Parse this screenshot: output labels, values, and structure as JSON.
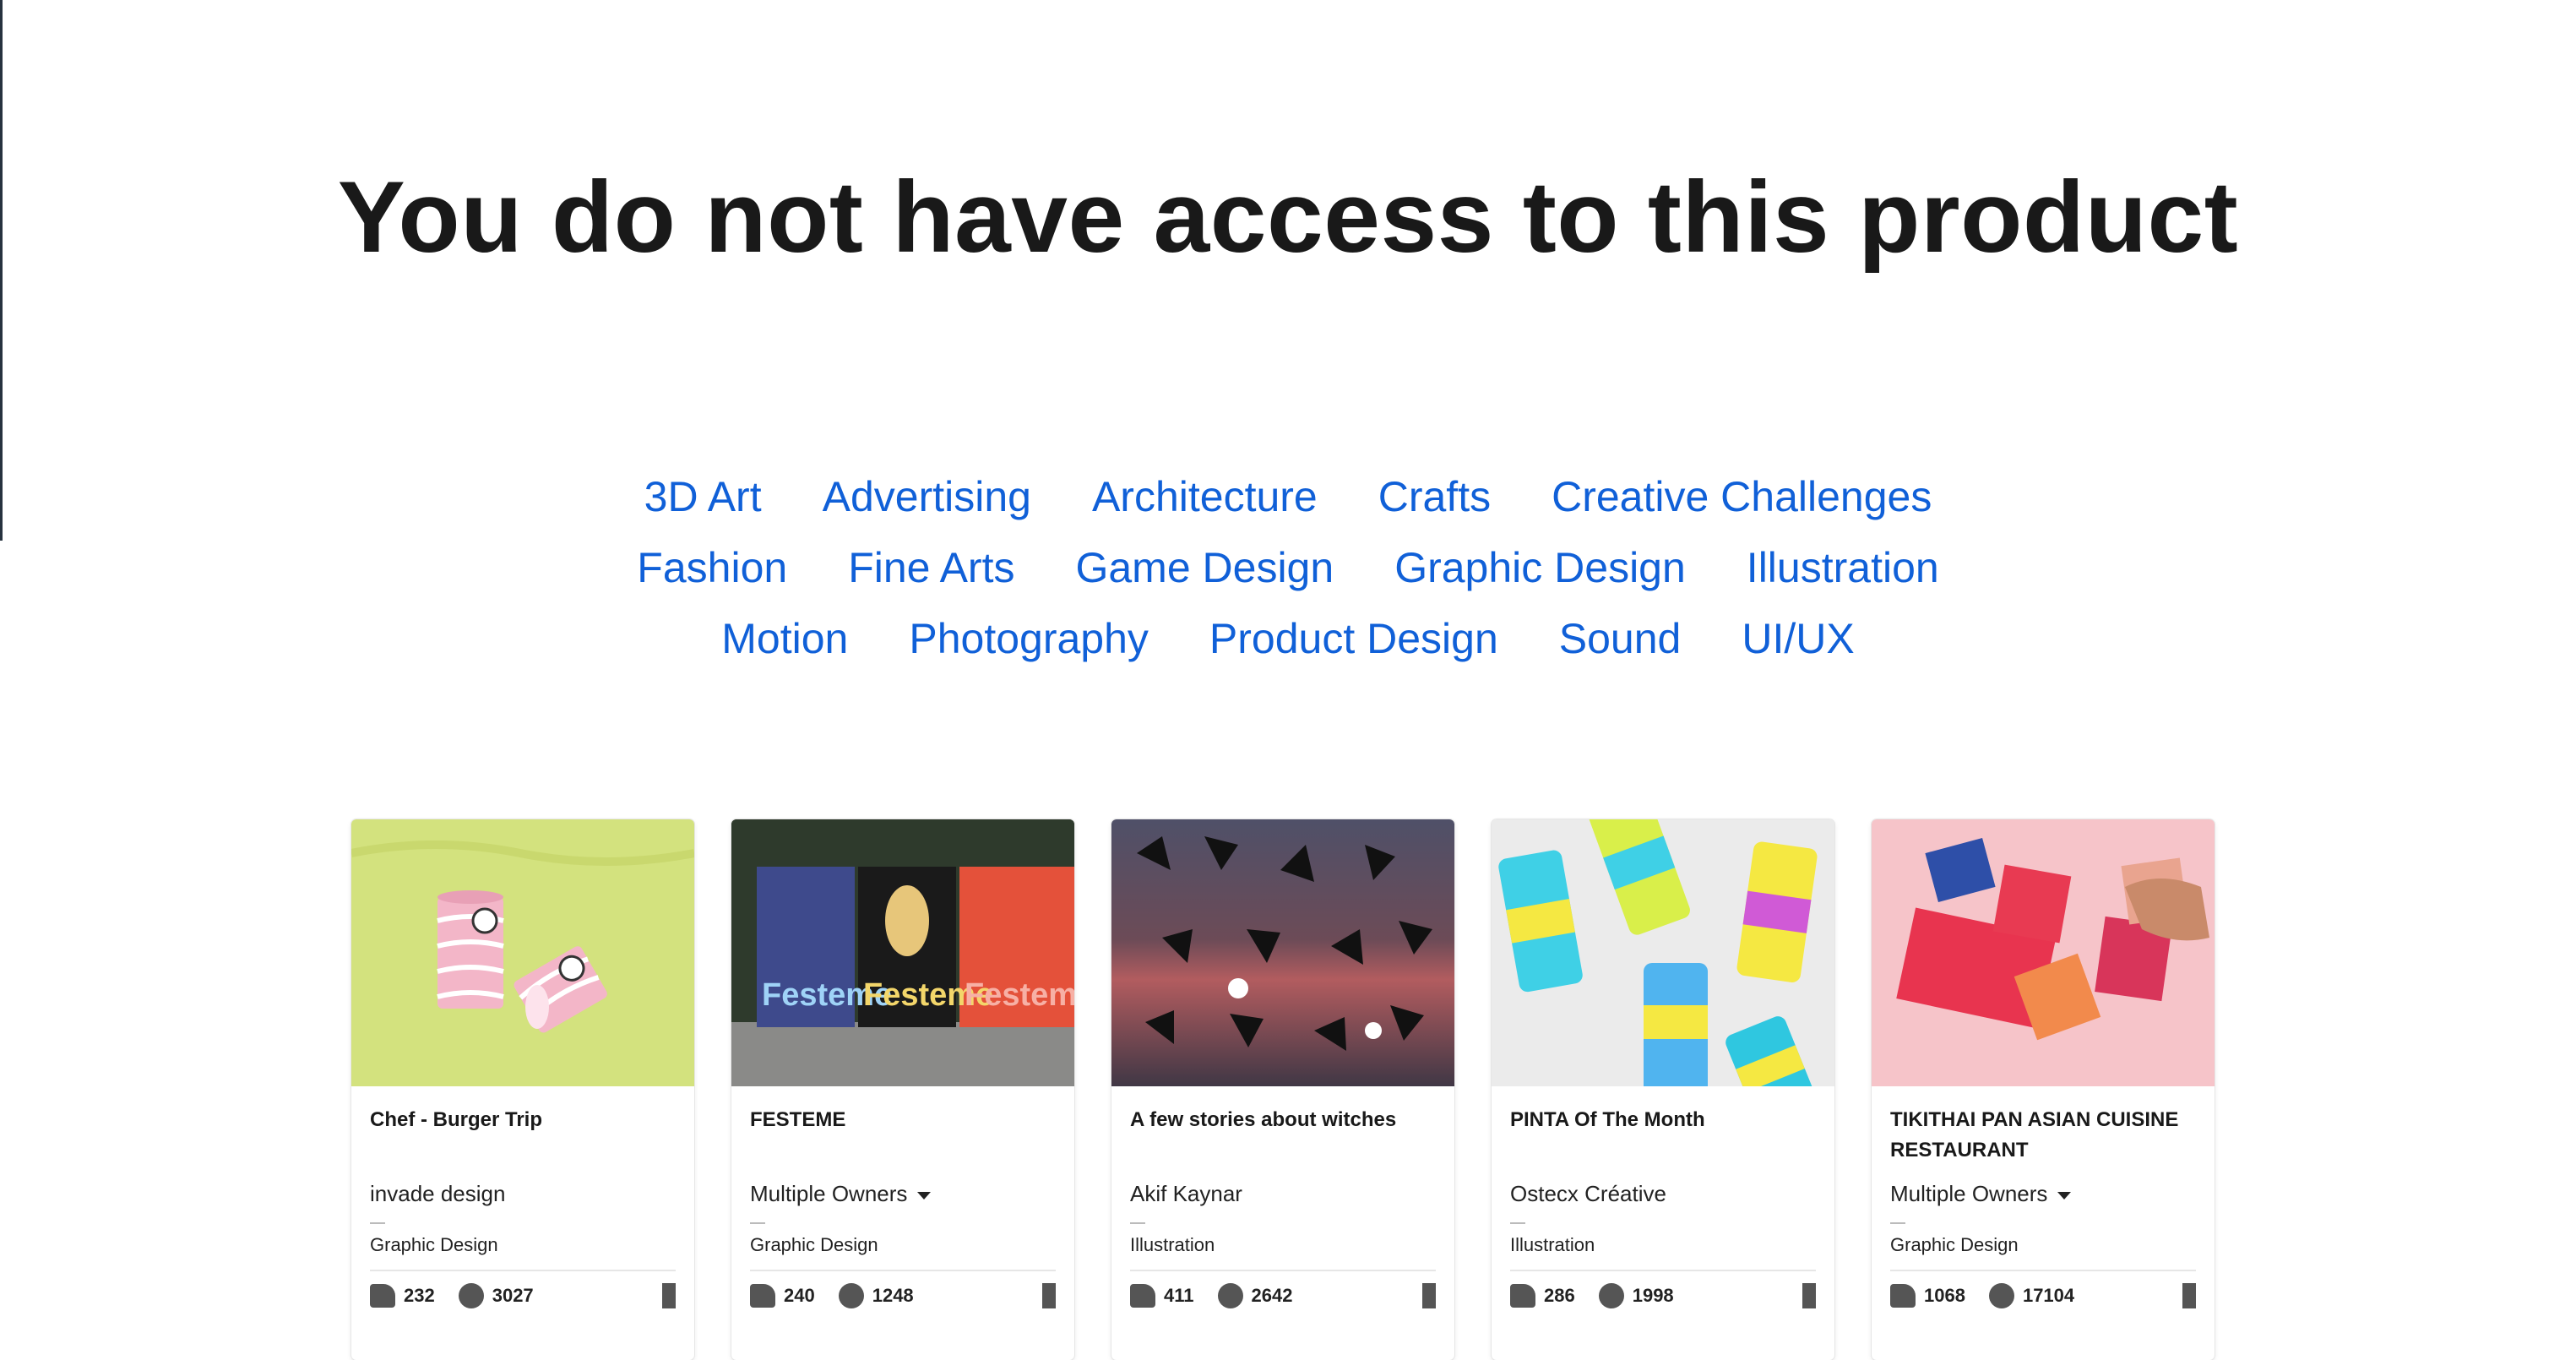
{
  "page": {
    "title": "You do not have access to this product"
  },
  "categories": [
    [
      "3D Art",
      "Advertising",
      "Architecture",
      "Crafts",
      "Creative Challenges"
    ],
    [
      "Fashion",
      "Fine Arts",
      "Game Design",
      "Graphic Design",
      "Illustration"
    ],
    [
      "Motion",
      "Photography",
      "Product Design",
      "Sound",
      "UI/UX"
    ]
  ],
  "cards": [
    {
      "title": "Chef - Burger Trip",
      "owner": "invade design",
      "owner_dropdown": false,
      "field": "Graphic Design",
      "likes": "232",
      "views": "3027"
    },
    {
      "title": "FESTEME",
      "owner": "Multiple Owners",
      "owner_dropdown": true,
      "field": "Graphic Design",
      "likes": "240",
      "views": "1248"
    },
    {
      "title": "A few stories about witches",
      "owner": "Akif Kaynar",
      "owner_dropdown": false,
      "field": "Illustration",
      "likes": "411",
      "views": "2642"
    },
    {
      "title": "PINTA Of The Month",
      "owner": "Ostecx Créative",
      "owner_dropdown": false,
      "field": "Illustration",
      "likes": "286",
      "views": "1998"
    },
    {
      "title": "TIKITHAI PAN ASIAN CUISINE RESTAURANT",
      "owner": "Multiple Owners",
      "owner_dropdown": true,
      "field": "Graphic Design",
      "likes": "1068",
      "views": "17104"
    }
  ],
  "thumb_text": {
    "festeme": "Festeme"
  }
}
